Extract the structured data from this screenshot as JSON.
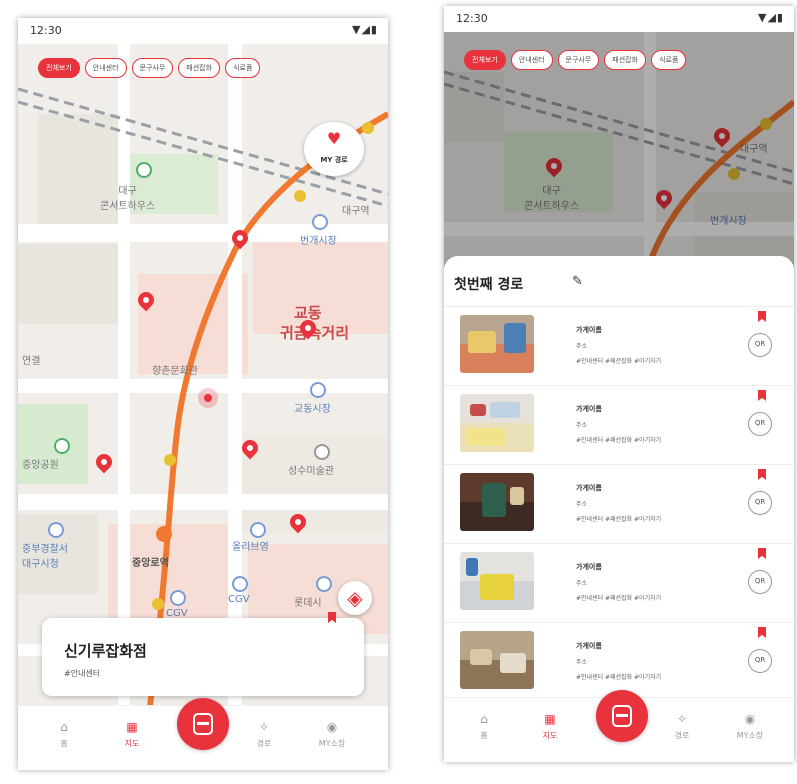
{
  "status_bar": {
    "time": "12:30",
    "signal_icons": "▼◢▮"
  },
  "filter_chips": [
    {
      "label": "전체보기",
      "active": true
    },
    {
      "label": "안내센터",
      "active": false
    },
    {
      "label": "문구사무",
      "active": false
    },
    {
      "label": "패션잡화",
      "active": false
    },
    {
      "label": "식료품",
      "active": false
    }
  ],
  "map": {
    "labels": {
      "concert_hall": "대구\n콘서트하우스",
      "bangye_market": "번개시장",
      "daegu_station": "대구역",
      "gyodong": "교동",
      "gyodong_alley": "귀금속거리",
      "gyodong_market": "교동시장",
      "seongsu_museum": "성수미술관",
      "jungang_park": "중앙공원",
      "jungbu_police": "중부경찰서\n대구시청",
      "jungangno_station": "중앙로역",
      "olive_young": "올리브영",
      "cgv": "CGV",
      "lotte": "롯데시",
      "hyangchon": "향촌문화관",
      "left_label": "연결"
    }
  },
  "my_route_button": {
    "icon": "heart-icon",
    "label": "MY 경로"
  },
  "place_card": {
    "name": "신기루잡화점",
    "tag": "#안내센터"
  },
  "bottom_nav": [
    {
      "label": "홈",
      "icon": "home-icon"
    },
    {
      "label": "지도",
      "icon": "map-icon"
    },
    {
      "label": "경로",
      "icon": "pin-icon"
    },
    {
      "label": "MY소장",
      "icon": "profile-icon"
    }
  ],
  "route_sheet": {
    "title": "첫번째 경로",
    "items": [
      {
        "name": "가게이름",
        "address": "주소",
        "tags": "#안내센터  #패션잡화  #아기자기",
        "qr": "QR"
      },
      {
        "name": "가게이름",
        "address": "주소",
        "tags": "#안내센터  #패션잡화  #아기자기",
        "qr": "QR"
      },
      {
        "name": "가게이름",
        "address": "주소",
        "tags": "#안내센터  #패션잡화  #아기자기",
        "qr": "QR"
      },
      {
        "name": "가게이름",
        "address": "주소",
        "tags": "#안내센터  #패션잡화  #아기자기",
        "qr": "QR"
      },
      {
        "name": "가게이름",
        "address": "주소",
        "tags": "#안내센터  #패션잡화  #아기자기",
        "qr": "QR"
      }
    ]
  },
  "colors": {
    "accent": "#e8323c",
    "route_line": "#f07830",
    "map_bg": "#f1eeea"
  }
}
